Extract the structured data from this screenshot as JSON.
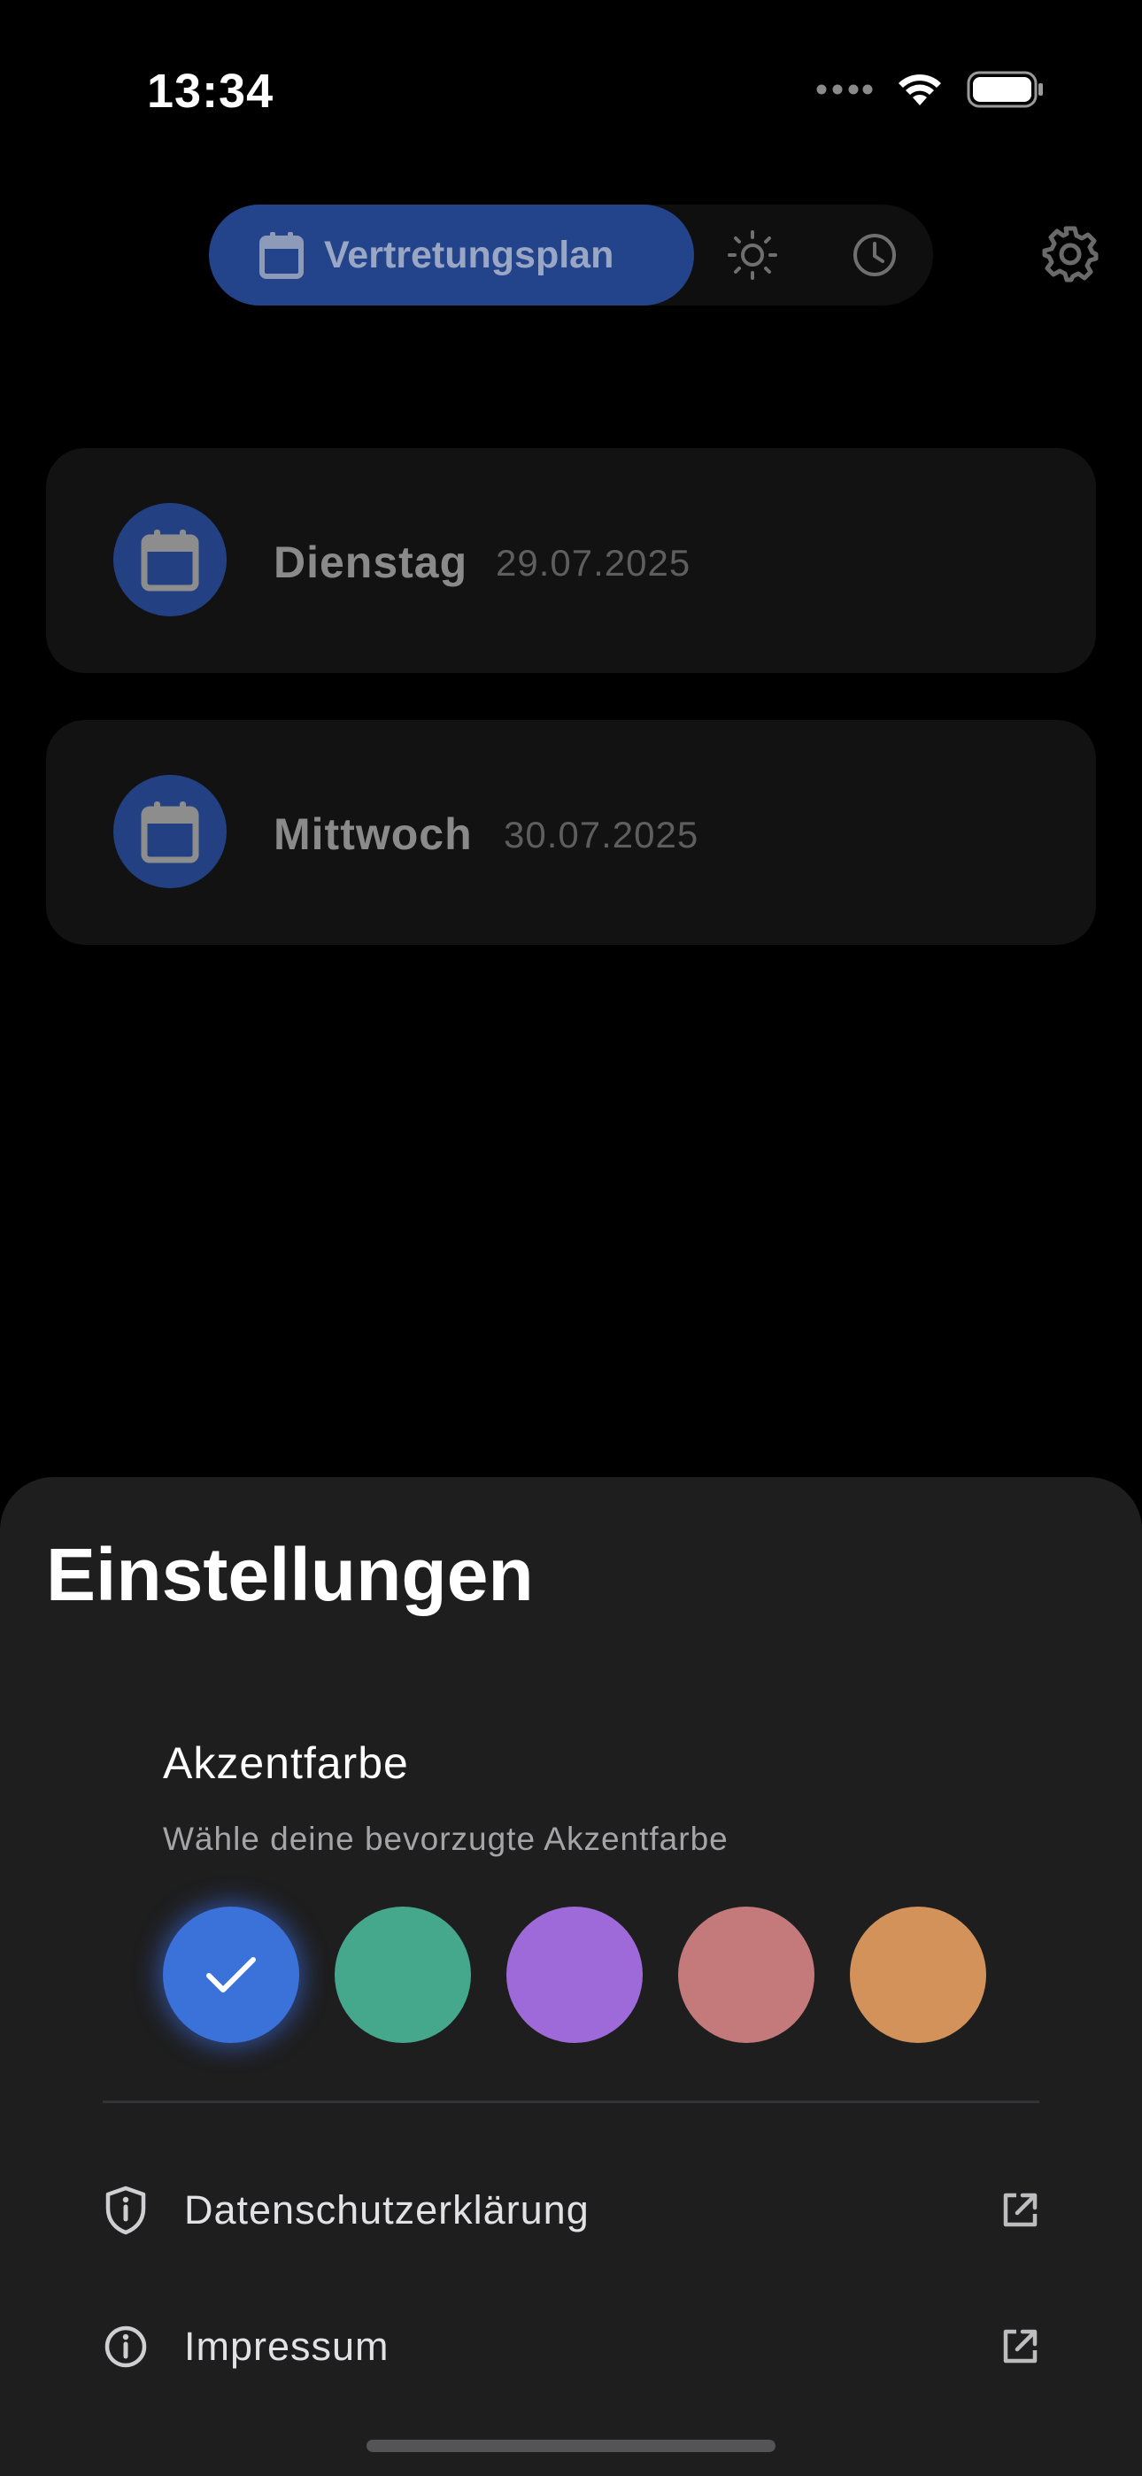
{
  "status_bar": {
    "time": "13:34",
    "icons": [
      "signal-dots-icon",
      "wifi-icon",
      "battery-icon"
    ]
  },
  "nav": {
    "active_tab_label": "Vertretungsplan",
    "active_tab_icon": "calendar-icon",
    "other_tabs": [
      {
        "icon": "sun-icon"
      },
      {
        "icon": "clock-icon"
      }
    ],
    "settings_icon": "gear-icon"
  },
  "days": [
    {
      "name": "Dienstag",
      "date": "29.07.2025"
    },
    {
      "name": "Mittwoch",
      "date": "30.07.2025"
    }
  ],
  "settings": {
    "title": "Einstellungen",
    "accent": {
      "title": "Akzentfarbe",
      "subtitle": "Wähle deine bevorzugte Akzentfarbe",
      "colors": [
        "#3b72d9",
        "#45a88c",
        "#9e6ad9",
        "#c47a7a",
        "#d4925b"
      ],
      "selected_index": 0
    },
    "links": [
      {
        "label": "Datenschutzerklärung",
        "icon": "shield-info-icon",
        "trailing_icon": "external-link-icon"
      },
      {
        "label": "Impressum",
        "icon": "info-icon",
        "trailing_icon": "external-link-icon"
      }
    ]
  },
  "colors": {
    "background": "#000000",
    "sheet": "#1e1e1f",
    "card": "#121212",
    "accent_dim": "#23438a"
  }
}
